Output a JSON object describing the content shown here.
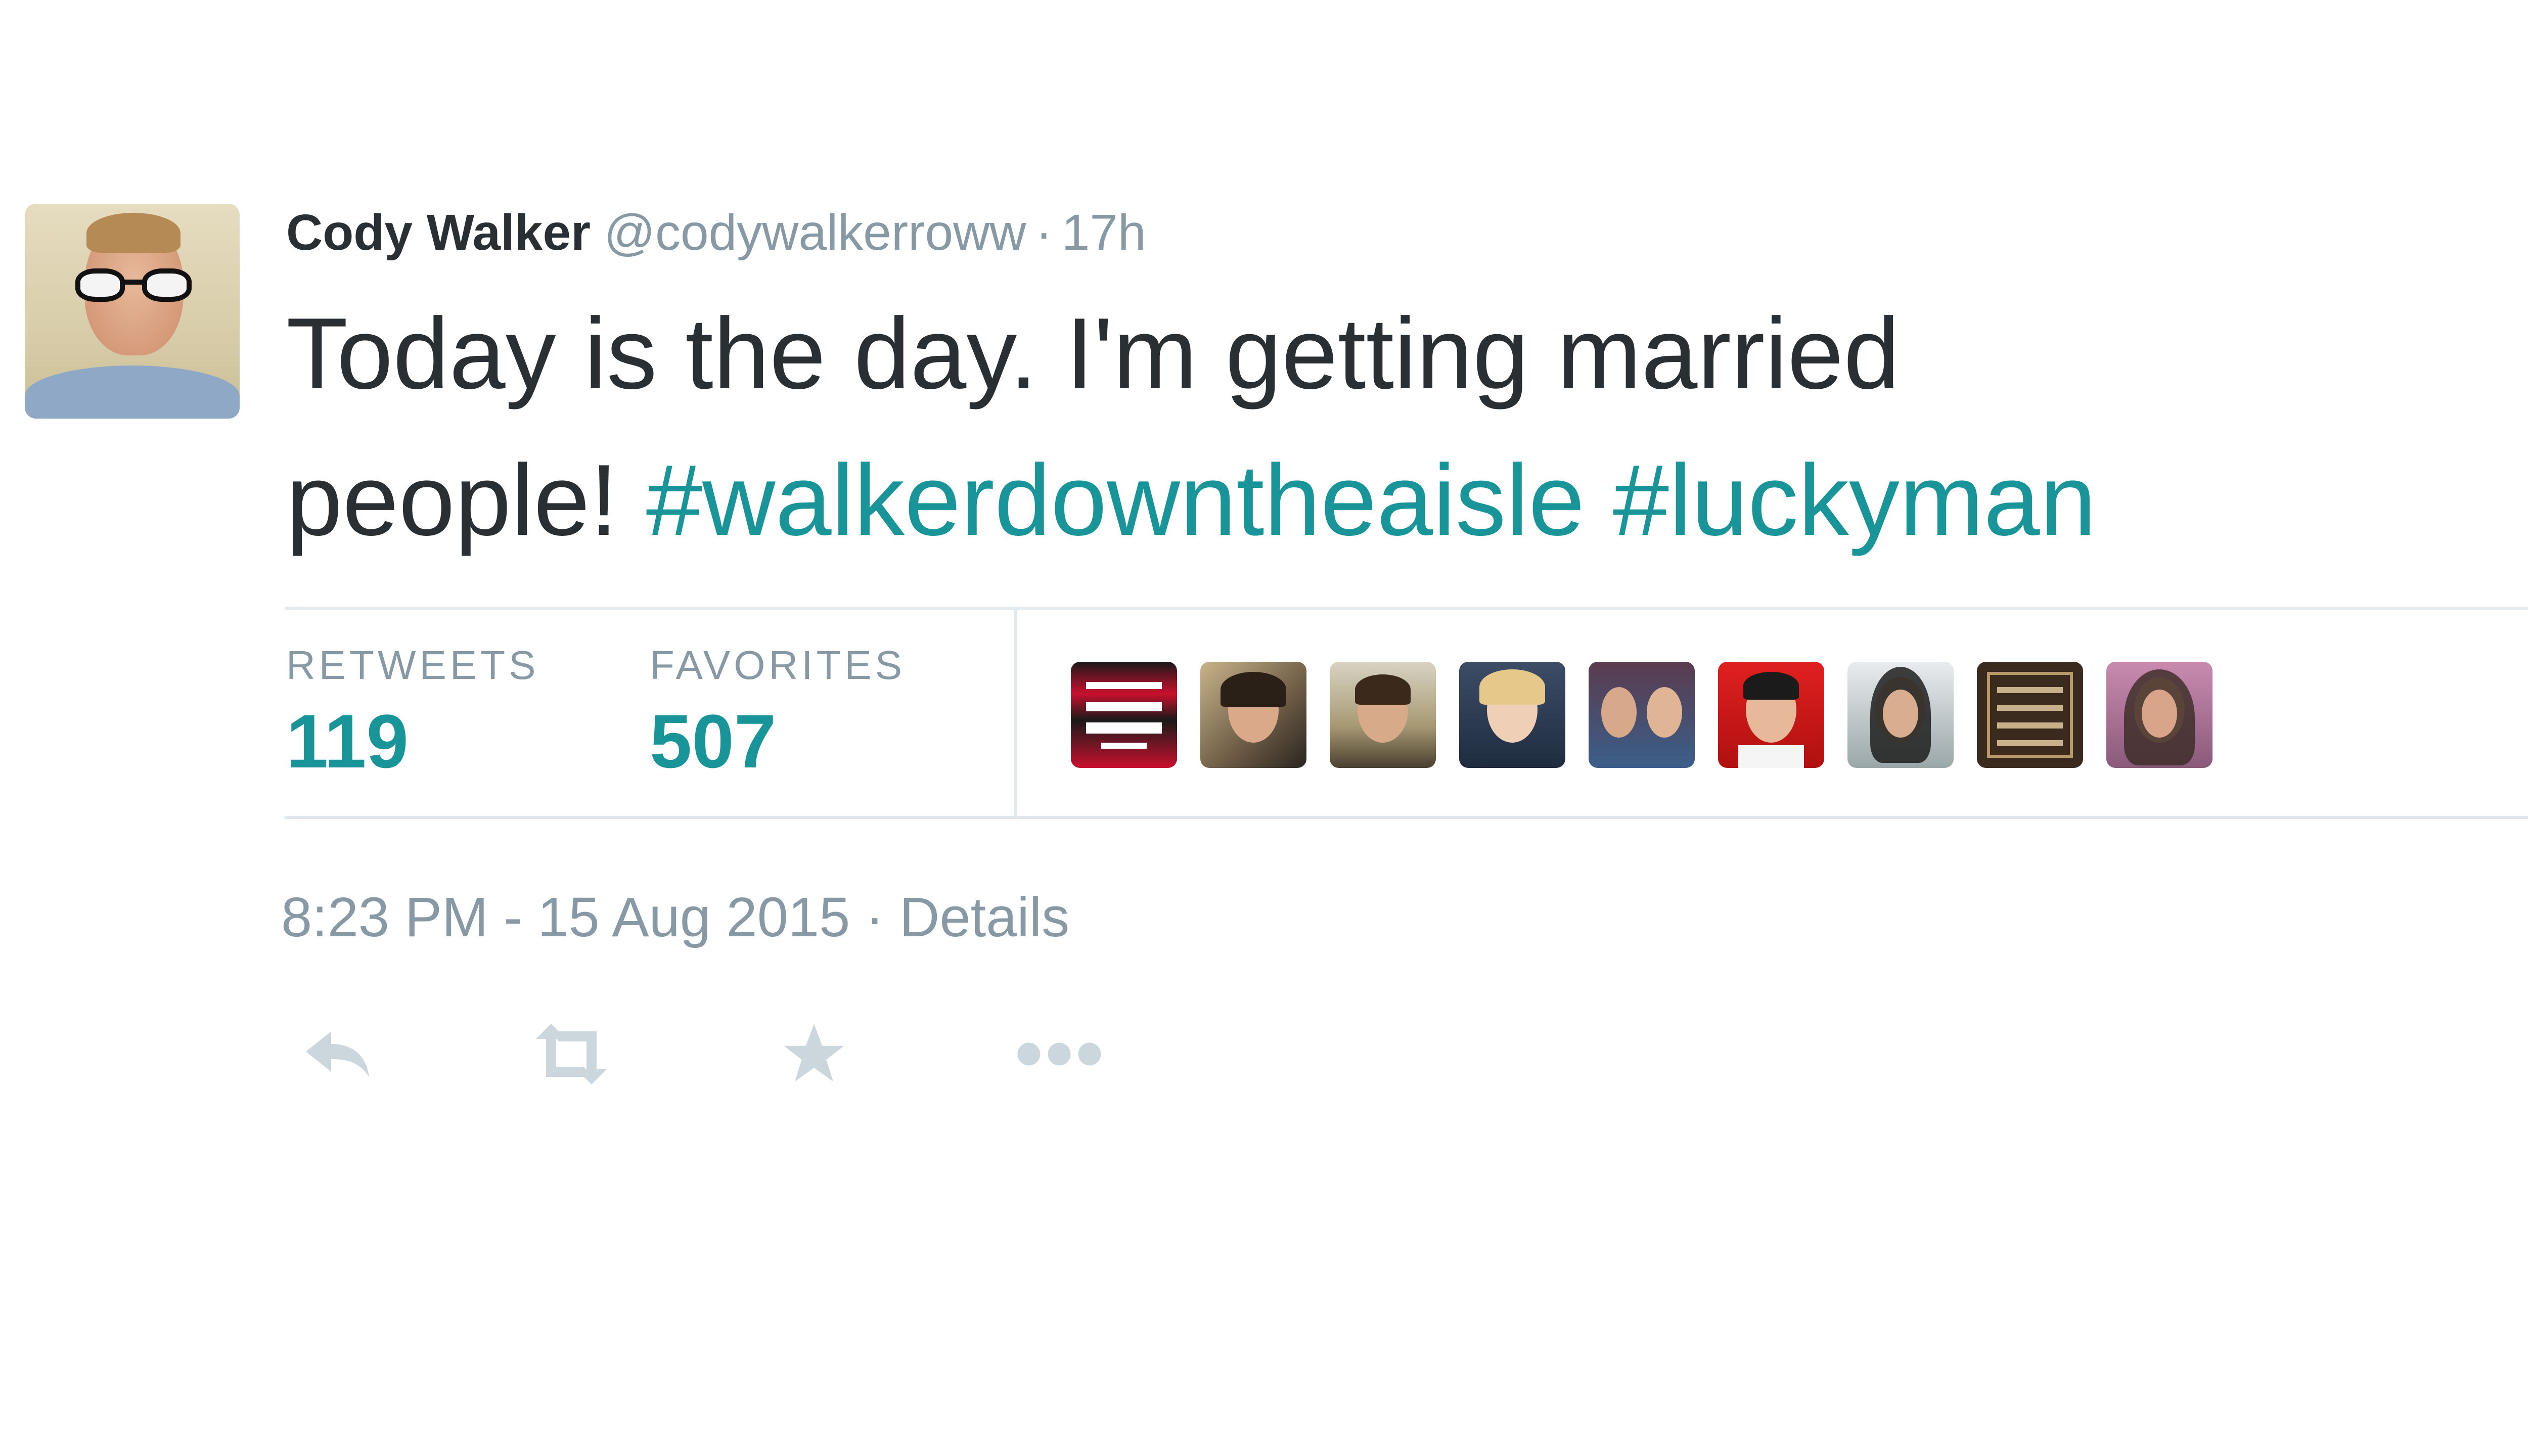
{
  "tweet": {
    "author_name": "Cody Walker",
    "handle": "@codywalkerroww",
    "separator": "·",
    "relative_time": "17h",
    "text_part1": "Today is the day. I'm getting married",
    "text_part2": "people! ",
    "hashtags": [
      "#walkerdowntheaisle",
      "#luckyman"
    ],
    "retweets_label": "RETWEETS",
    "retweets_count": "119",
    "favorites_label": "FAVORITES",
    "favorites_count": "507",
    "timestamp": "8:23 PM - 15 Aug 2015",
    "details_label": "Details"
  },
  "actions": [
    {
      "name": "reply-icon"
    },
    {
      "name": "retweet-icon"
    },
    {
      "name": "favorite-star-icon"
    },
    {
      "name": "more-options-icon"
    }
  ],
  "favoriters": [
    {
      "name": "favoriter-avatar-1"
    },
    {
      "name": "favoriter-avatar-2"
    },
    {
      "name": "favoriter-avatar-3"
    },
    {
      "name": "favoriter-avatar-4"
    },
    {
      "name": "favoriter-avatar-5"
    },
    {
      "name": "favoriter-avatar-6"
    },
    {
      "name": "favoriter-avatar-7"
    },
    {
      "name": "favoriter-avatar-8"
    },
    {
      "name": "favoriter-avatar-9"
    }
  ],
  "colors": {
    "text": "#292f33",
    "muted": "#8899a6",
    "hashtag": "#19959a",
    "divider": "#e1e8ed"
  }
}
